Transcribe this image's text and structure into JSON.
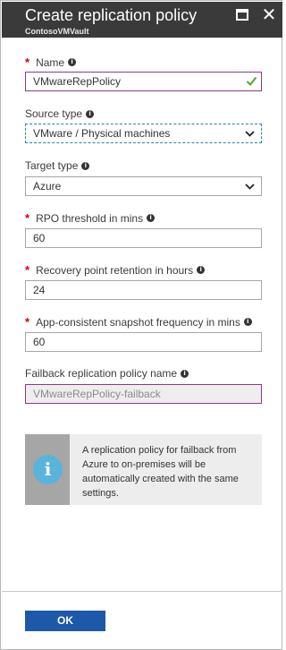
{
  "header": {
    "title": "Create replication policy",
    "subtitle": "ContosoVMVault"
  },
  "fields": {
    "name": {
      "label": "Name",
      "required": true,
      "value": "VMwareRepPolicy",
      "status": "valid"
    },
    "source_type": {
      "label": "Source type",
      "required": false,
      "value": "VMware / Physical machines"
    },
    "target_type": {
      "label": "Target type",
      "required": false,
      "value": "Azure"
    },
    "rpo_threshold": {
      "label": "RPO threshold in mins",
      "required": true,
      "value": "60"
    },
    "recovery_retention": {
      "label": "Recovery point retention in hours",
      "required": true,
      "value": "24"
    },
    "snapshot_frequency": {
      "label": "App-consistent snapshot frequency in mins",
      "required": true,
      "value": "60"
    },
    "failback_policy": {
      "label": "Failback replication policy name",
      "required": false,
      "value": "VMwareRepPolicy-failback"
    }
  },
  "callout": {
    "icon": "info-icon",
    "icon_glyph": "i",
    "text": "A replication policy for failback from Azure to on-premises will be automatically created with the same settings."
  },
  "footer": {
    "ok_label": "OK"
  },
  "colors": {
    "header_bg": "#3a3a3a",
    "required_star": "#d00000",
    "valid_check": "#5aa02c",
    "primary_button": "#1e58a8",
    "info_icon": "#59b4d9"
  },
  "glyphs": {
    "required_star": "*",
    "info": "i"
  }
}
